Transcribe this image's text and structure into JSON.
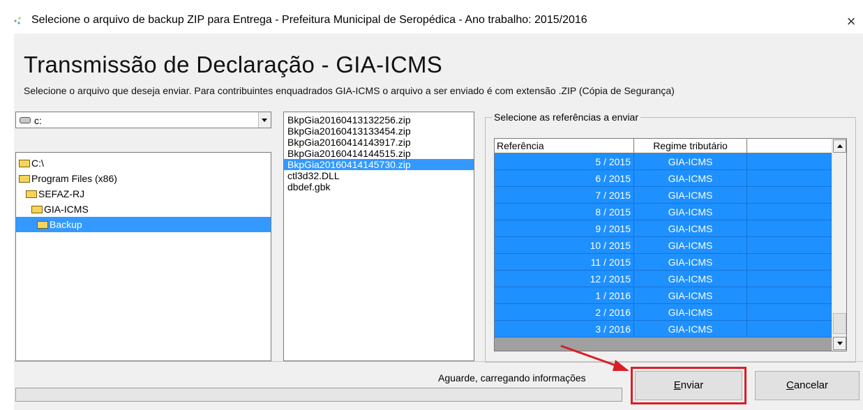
{
  "window": {
    "title": "Selecione o arquivo de backup ZIP para Entrega  - Prefeitura Municipal de Seropédica - Ano trabalho: 2015/2016",
    "close_glyph": "×"
  },
  "heading": "Transmissão de Declaração - GIA-ICMS",
  "subtitle": "Selecione o arquivo que deseja enviar. Para contribuintes enquadrados GIA-ICMS o arquivo a ser enviado é com extensão .ZIP (Cópia de Segurança)",
  "drive": {
    "value": "c:",
    "icon": "drive-icon"
  },
  "folders": [
    {
      "label": "C:\\"
    },
    {
      "label": "Program Files (x86)"
    },
    {
      "label": "SEFAZ-RJ"
    },
    {
      "label": "GIA-ICMS"
    },
    {
      "label": "Backup"
    }
  ],
  "selected_folder": "Backup",
  "files": [
    {
      "name": "BkpGia20160413132256.zip"
    },
    {
      "name": "BkpGia20160413133454.zip"
    },
    {
      "name": "BkpGia20160414143917.zip"
    },
    {
      "name": "BkpGia20160414144515.zip"
    },
    {
      "name": "BkpGia20160414145730.zip"
    },
    {
      "name": "ctl3d32.DLL"
    },
    {
      "name": "dbdef.gbk"
    }
  ],
  "selected_file": "BkpGia20160414145730.zip",
  "references": {
    "group_title": "Selecione as referências a enviar",
    "columns": [
      "Referência",
      "Regime tributário"
    ],
    "rows": [
      {
        "ref": "5 / 2015",
        "regime": "GIA-ICMS"
      },
      {
        "ref": "6 / 2015",
        "regime": "GIA-ICMS"
      },
      {
        "ref": "7 / 2015",
        "regime": "GIA-ICMS"
      },
      {
        "ref": "8 / 2015",
        "regime": "GIA-ICMS"
      },
      {
        "ref": "9 / 2015",
        "regime": "GIA-ICMS"
      },
      {
        "ref": "10 / 2015",
        "regime": "GIA-ICMS"
      },
      {
        "ref": "11 / 2015",
        "regime": "GIA-ICMS"
      },
      {
        "ref": "12 / 2015",
        "regime": "GIA-ICMS"
      },
      {
        "ref": "1 / 2016",
        "regime": "GIA-ICMS"
      },
      {
        "ref": "2 / 2016",
        "regime": "GIA-ICMS"
      },
      {
        "ref": "3 / 2016",
        "regime": "GIA-ICMS"
      }
    ]
  },
  "status_text": "Aguarde, carregando informações",
  "buttons": {
    "send_first": "E",
    "send_rest": "nviar",
    "cancel_first": "C",
    "cancel_rest": "ancelar"
  },
  "colors": {
    "selection": "#3399ff",
    "grid_row": "#1e90ff",
    "highlight": "#d91f26"
  }
}
